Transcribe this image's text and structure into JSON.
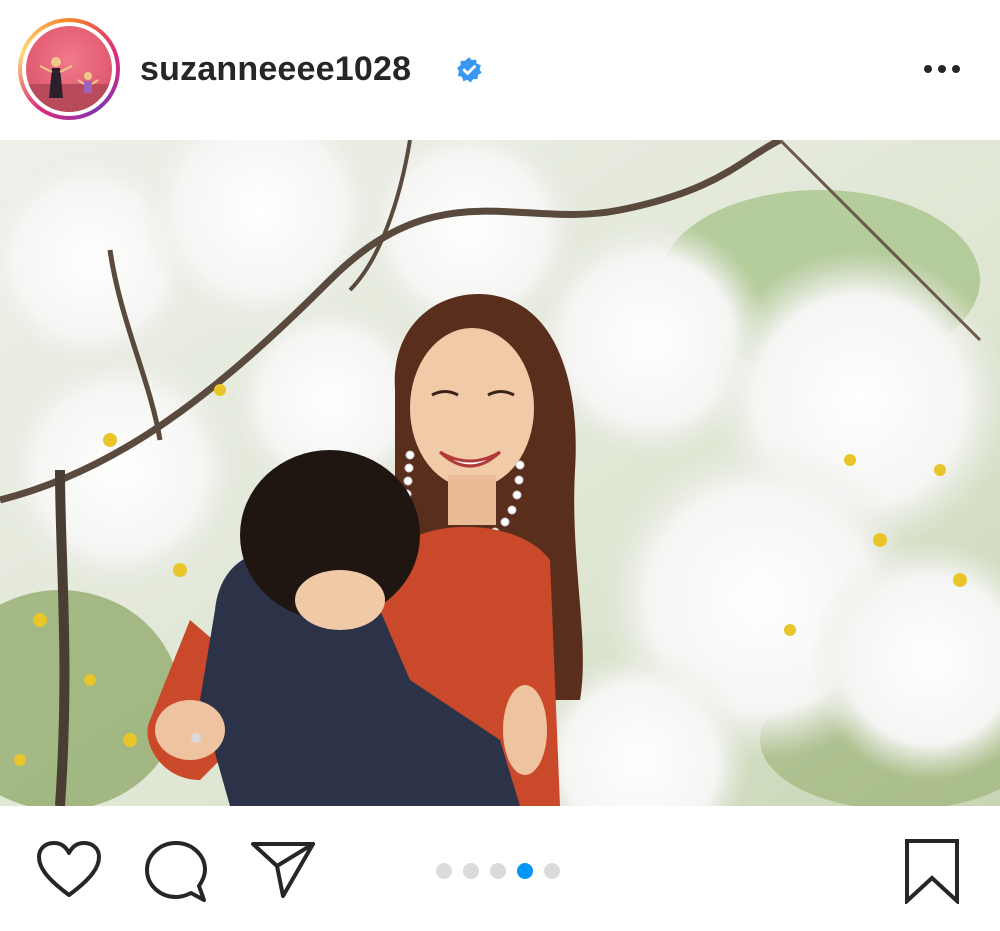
{
  "post": {
    "username": "suzanneeee1028",
    "verified": true,
    "verified_icon": "verified-badge-icon",
    "more_icon": "more-options-icon"
  },
  "actions": {
    "like_icon": "heart-icon",
    "comment_icon": "comment-icon",
    "share_icon": "send-icon",
    "save_icon": "bookmark-icon"
  },
  "carousel": {
    "total": 5,
    "active_index": 3
  },
  "colors": {
    "accent": "#0095f6",
    "text": "#262626",
    "dot_inactive": "#dbdbdb"
  }
}
